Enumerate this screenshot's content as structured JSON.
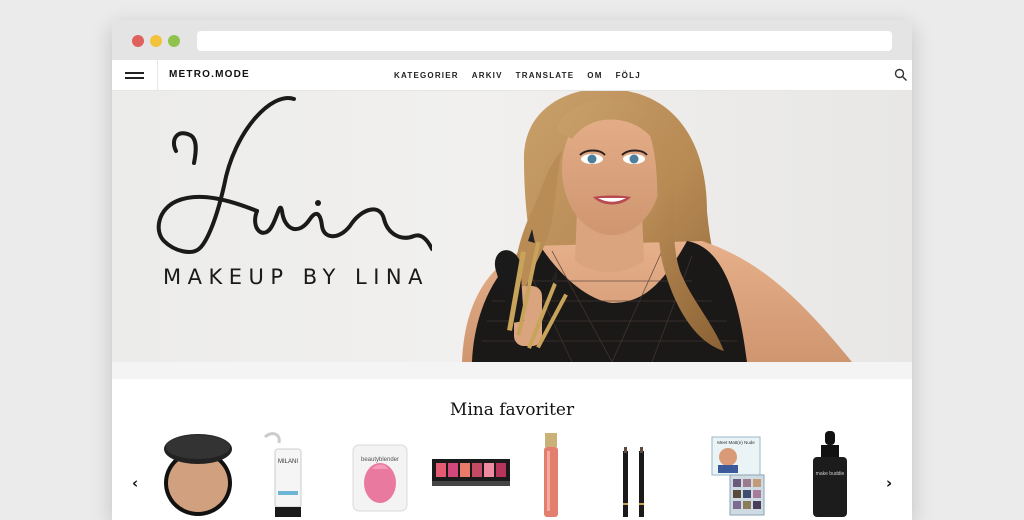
{
  "browser": {
    "url": ""
  },
  "nav": {
    "brand": "METRO.MODE",
    "links": [
      "KATEGORIER",
      "ARKIV",
      "TRANSLATE",
      "OM",
      "FÖLJ"
    ]
  },
  "hero": {
    "tagline": "MAKEUP BY LINA"
  },
  "favorites": {
    "title": "Mina favoriter",
    "prev": "‹",
    "next": "›",
    "products": [
      {
        "name": "compact-powder"
      },
      {
        "name": "primer-tube",
        "label": "MILANI"
      },
      {
        "name": "beautyblender",
        "label": "beautyblender"
      },
      {
        "name": "blush-palette"
      },
      {
        "name": "lip-gloss"
      },
      {
        "name": "eyebrow-pencils"
      },
      {
        "name": "eyeshadow-palette",
        "label": "Meet Matt(e) Nude"
      },
      {
        "name": "serum-bottle",
        "label": "make buddie"
      }
    ]
  },
  "colors": {
    "accent": "#111111",
    "background": "#ebebeb"
  }
}
